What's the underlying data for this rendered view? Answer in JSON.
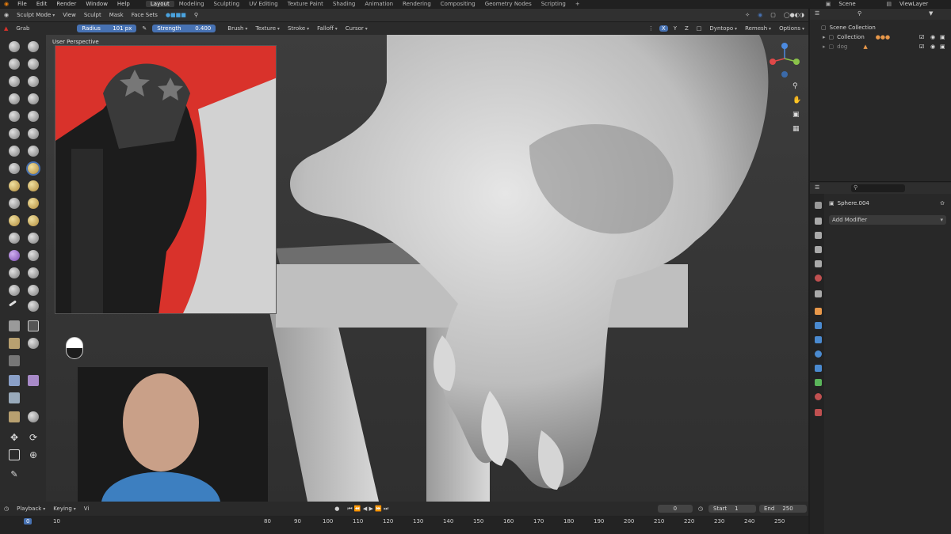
{
  "menu": [
    "File",
    "Edit",
    "Render",
    "Window",
    "Help"
  ],
  "workspaces": [
    "Layout",
    "Modeling",
    "Sculpting",
    "UV Editing",
    "Texture Paint",
    "Shading",
    "Animation",
    "Rendering",
    "Compositing",
    "Geometry Nodes",
    "Scripting"
  ],
  "active_workspace": "Layout",
  "scene_name": "Scene",
  "view_layer": "ViewLayer",
  "header": {
    "mode": "Sculpt Mode",
    "items": [
      "View",
      "Sculpt",
      "Mask",
      "Face Sets"
    ],
    "options": "Options"
  },
  "tool_settings": {
    "brush_name": "Grab",
    "radius_label": "Radius",
    "radius_value": "101 px",
    "strength_label": "Strength",
    "strength_value": "0.400",
    "menus": [
      "Brush",
      "Texture",
      "Stroke",
      "Falloff",
      "Cursor"
    ],
    "axes": [
      "X",
      "Y",
      "Z"
    ],
    "dyntopo": "Dyntopo",
    "remesh": "Remesh"
  },
  "viewport": {
    "label": "User Perspective"
  },
  "outliner": {
    "root": "Scene Collection",
    "collection": "Collection",
    "item": "dog"
  },
  "properties": {
    "object_name": "Sphere.004",
    "add_modifier": "Add Modifier"
  },
  "timeline": {
    "playback": "Playback",
    "keying": "Keying",
    "view": "Vi",
    "current_frame": "0",
    "start_label": "Start",
    "start_value": "1",
    "end_label": "End",
    "end_value": "250",
    "ticks": [
      "0",
      "10",
      "80",
      "90",
      "100",
      "110",
      "120",
      "130",
      "140",
      "150",
      "160",
      "170",
      "180",
      "190",
      "200",
      "210",
      "220",
      "230",
      "240",
      "250"
    ]
  },
  "colors": {
    "accent": "#4772b3",
    "reference_bg": "#d9322b"
  }
}
